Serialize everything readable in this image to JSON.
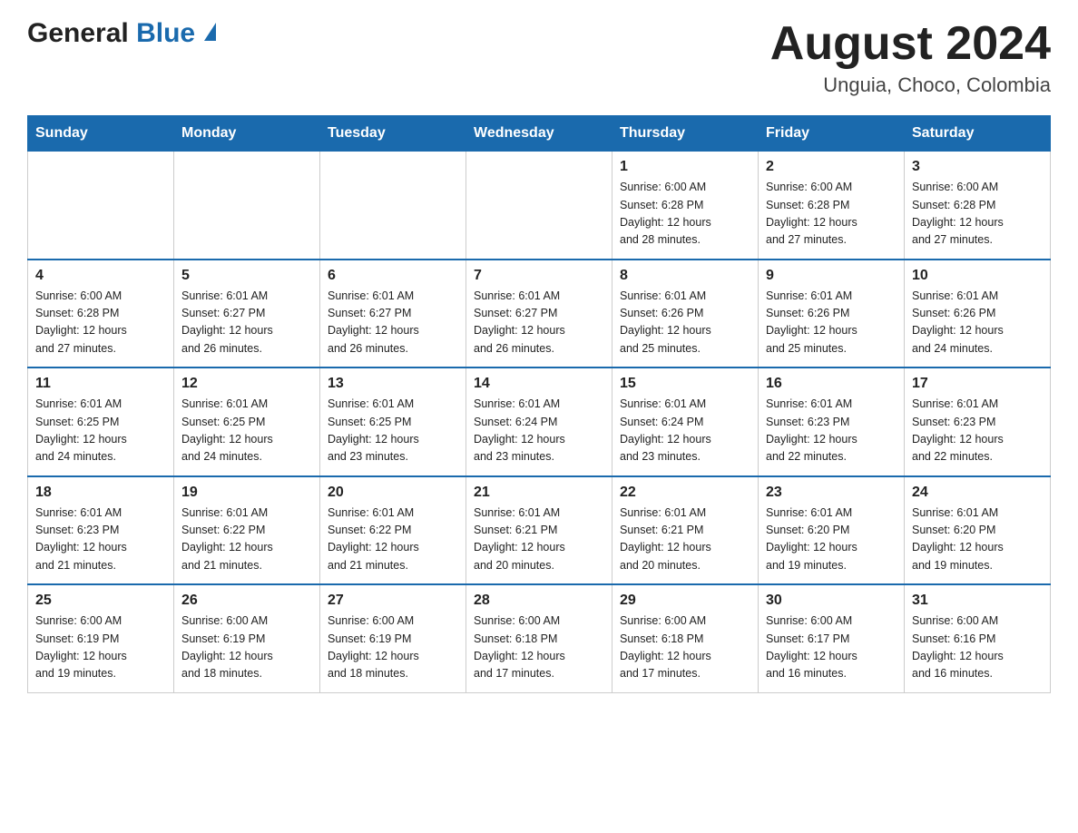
{
  "header": {
    "logo": {
      "general": "General",
      "blue": "Blue"
    },
    "month": "August 2024",
    "location": "Unguia, Choco, Colombia"
  },
  "weekdays": [
    "Sunday",
    "Monday",
    "Tuesday",
    "Wednesday",
    "Thursday",
    "Friday",
    "Saturday"
  ],
  "weeks": [
    [
      {
        "day": "",
        "details": ""
      },
      {
        "day": "",
        "details": ""
      },
      {
        "day": "",
        "details": ""
      },
      {
        "day": "",
        "details": ""
      },
      {
        "day": "1",
        "details": "Sunrise: 6:00 AM\nSunset: 6:28 PM\nDaylight: 12 hours\nand 28 minutes."
      },
      {
        "day": "2",
        "details": "Sunrise: 6:00 AM\nSunset: 6:28 PM\nDaylight: 12 hours\nand 27 minutes."
      },
      {
        "day": "3",
        "details": "Sunrise: 6:00 AM\nSunset: 6:28 PM\nDaylight: 12 hours\nand 27 minutes."
      }
    ],
    [
      {
        "day": "4",
        "details": "Sunrise: 6:00 AM\nSunset: 6:28 PM\nDaylight: 12 hours\nand 27 minutes."
      },
      {
        "day": "5",
        "details": "Sunrise: 6:01 AM\nSunset: 6:27 PM\nDaylight: 12 hours\nand 26 minutes."
      },
      {
        "day": "6",
        "details": "Sunrise: 6:01 AM\nSunset: 6:27 PM\nDaylight: 12 hours\nand 26 minutes."
      },
      {
        "day": "7",
        "details": "Sunrise: 6:01 AM\nSunset: 6:27 PM\nDaylight: 12 hours\nand 26 minutes."
      },
      {
        "day": "8",
        "details": "Sunrise: 6:01 AM\nSunset: 6:26 PM\nDaylight: 12 hours\nand 25 minutes."
      },
      {
        "day": "9",
        "details": "Sunrise: 6:01 AM\nSunset: 6:26 PM\nDaylight: 12 hours\nand 25 minutes."
      },
      {
        "day": "10",
        "details": "Sunrise: 6:01 AM\nSunset: 6:26 PM\nDaylight: 12 hours\nand 24 minutes."
      }
    ],
    [
      {
        "day": "11",
        "details": "Sunrise: 6:01 AM\nSunset: 6:25 PM\nDaylight: 12 hours\nand 24 minutes."
      },
      {
        "day": "12",
        "details": "Sunrise: 6:01 AM\nSunset: 6:25 PM\nDaylight: 12 hours\nand 24 minutes."
      },
      {
        "day": "13",
        "details": "Sunrise: 6:01 AM\nSunset: 6:25 PM\nDaylight: 12 hours\nand 23 minutes."
      },
      {
        "day": "14",
        "details": "Sunrise: 6:01 AM\nSunset: 6:24 PM\nDaylight: 12 hours\nand 23 minutes."
      },
      {
        "day": "15",
        "details": "Sunrise: 6:01 AM\nSunset: 6:24 PM\nDaylight: 12 hours\nand 23 minutes."
      },
      {
        "day": "16",
        "details": "Sunrise: 6:01 AM\nSunset: 6:23 PM\nDaylight: 12 hours\nand 22 minutes."
      },
      {
        "day": "17",
        "details": "Sunrise: 6:01 AM\nSunset: 6:23 PM\nDaylight: 12 hours\nand 22 minutes."
      }
    ],
    [
      {
        "day": "18",
        "details": "Sunrise: 6:01 AM\nSunset: 6:23 PM\nDaylight: 12 hours\nand 21 minutes."
      },
      {
        "day": "19",
        "details": "Sunrise: 6:01 AM\nSunset: 6:22 PM\nDaylight: 12 hours\nand 21 minutes."
      },
      {
        "day": "20",
        "details": "Sunrise: 6:01 AM\nSunset: 6:22 PM\nDaylight: 12 hours\nand 21 minutes."
      },
      {
        "day": "21",
        "details": "Sunrise: 6:01 AM\nSunset: 6:21 PM\nDaylight: 12 hours\nand 20 minutes."
      },
      {
        "day": "22",
        "details": "Sunrise: 6:01 AM\nSunset: 6:21 PM\nDaylight: 12 hours\nand 20 minutes."
      },
      {
        "day": "23",
        "details": "Sunrise: 6:01 AM\nSunset: 6:20 PM\nDaylight: 12 hours\nand 19 minutes."
      },
      {
        "day": "24",
        "details": "Sunrise: 6:01 AM\nSunset: 6:20 PM\nDaylight: 12 hours\nand 19 minutes."
      }
    ],
    [
      {
        "day": "25",
        "details": "Sunrise: 6:00 AM\nSunset: 6:19 PM\nDaylight: 12 hours\nand 19 minutes."
      },
      {
        "day": "26",
        "details": "Sunrise: 6:00 AM\nSunset: 6:19 PM\nDaylight: 12 hours\nand 18 minutes."
      },
      {
        "day": "27",
        "details": "Sunrise: 6:00 AM\nSunset: 6:19 PM\nDaylight: 12 hours\nand 18 minutes."
      },
      {
        "day": "28",
        "details": "Sunrise: 6:00 AM\nSunset: 6:18 PM\nDaylight: 12 hours\nand 17 minutes."
      },
      {
        "day": "29",
        "details": "Sunrise: 6:00 AM\nSunset: 6:18 PM\nDaylight: 12 hours\nand 17 minutes."
      },
      {
        "day": "30",
        "details": "Sunrise: 6:00 AM\nSunset: 6:17 PM\nDaylight: 12 hours\nand 16 minutes."
      },
      {
        "day": "31",
        "details": "Sunrise: 6:00 AM\nSunset: 6:16 PM\nDaylight: 12 hours\nand 16 minutes."
      }
    ]
  ]
}
